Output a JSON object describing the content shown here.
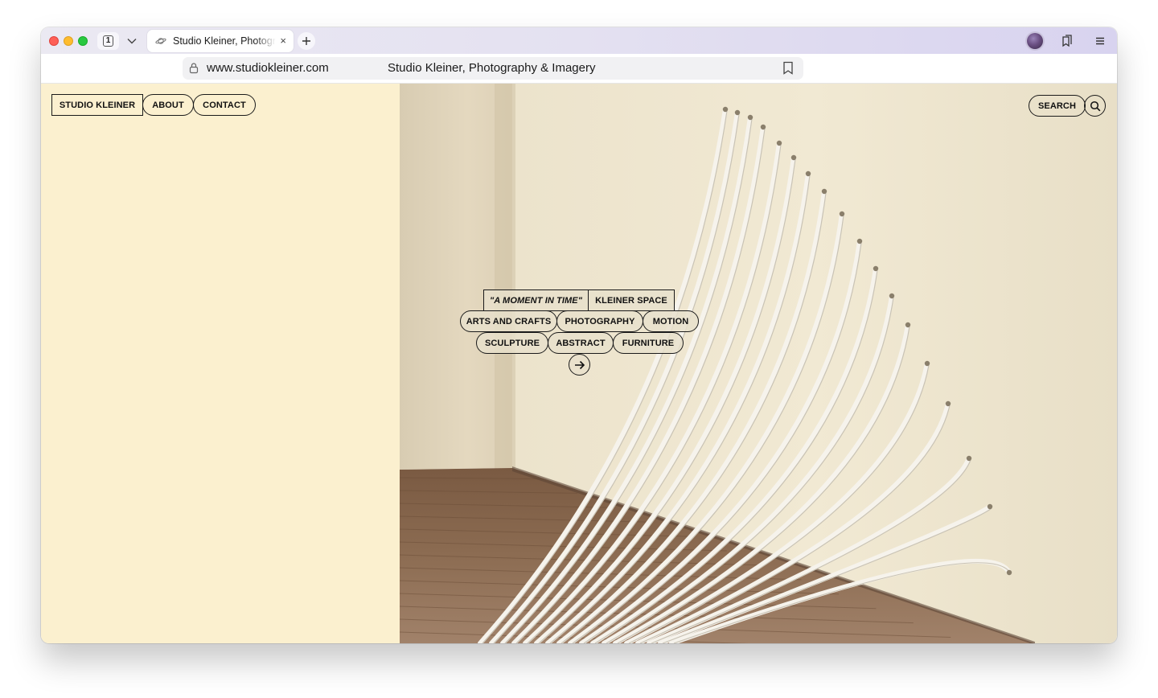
{
  "browser": {
    "tab_count": "1",
    "tab_title": "Studio Kleiner, Photography & Imagery",
    "tab_close": "×",
    "url": "www.studiokleiner.com",
    "page_title": "Studio Kleiner, Photography & Imagery"
  },
  "colors": {
    "left_panel_bg": "#fbf0cf",
    "ink": "#1a1a1a"
  },
  "nav": {
    "brand": "STUDIO KLEINER",
    "about": "ABOUT",
    "contact": "CONTACT",
    "search": "SEARCH"
  },
  "featured": {
    "title": "\"A MOMENT IN TIME\"",
    "location": "KLEINER SPACE"
  },
  "tags": {
    "row1": [
      "ARTS AND CRAFTS",
      "PHOTOGRAPHY",
      "MOTION"
    ],
    "row2": [
      "SCULPTURE",
      "ABSTRACT",
      "FURNITURE"
    ]
  },
  "icons": {
    "next": "arrow-right-icon",
    "search": "search-icon"
  }
}
